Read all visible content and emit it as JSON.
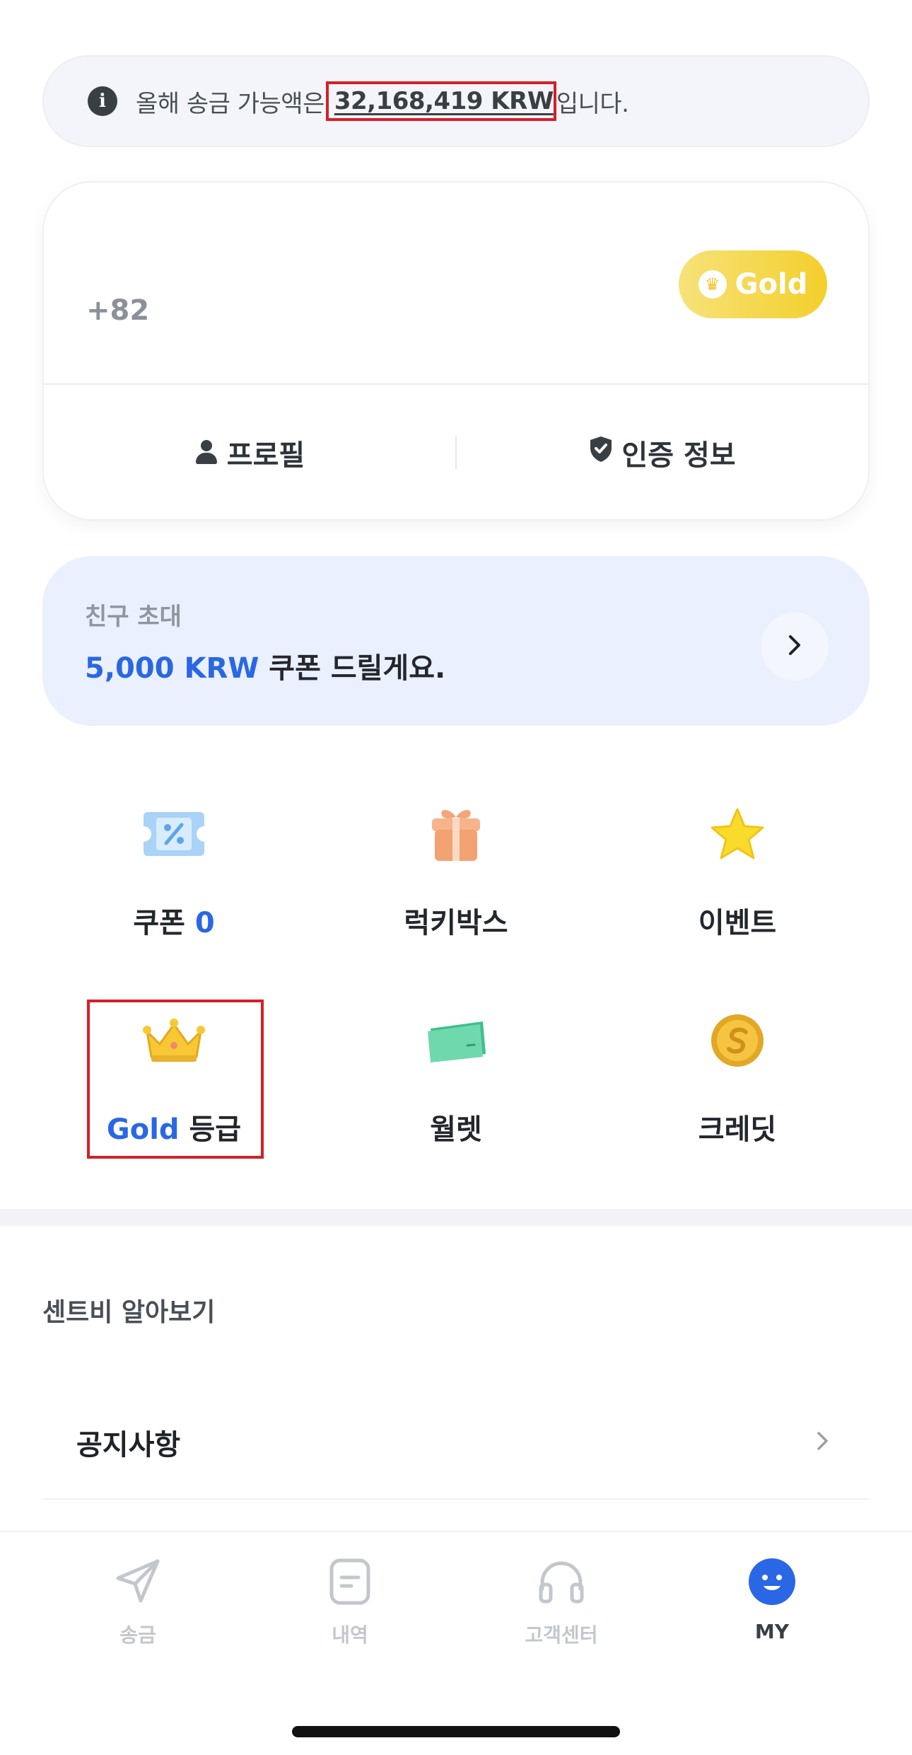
{
  "notice": {
    "prefix": "올해 송금 가능액은 ",
    "amount": "32,168,419 KRW",
    "suffix": "입니다."
  },
  "profile": {
    "phone": "+82",
    "grade_badge": "Gold",
    "actions": {
      "profile_label": "프로필",
      "verification_label": "인증 정보"
    }
  },
  "invite": {
    "label": "친구 초대",
    "amount": "5,000 KRW",
    "text": " 쿠폰 드릴게요."
  },
  "grid": {
    "coupon": {
      "label": "쿠폰 ",
      "count": "0"
    },
    "luckybox": {
      "label": "럭키박스"
    },
    "event": {
      "label": "이벤트"
    },
    "grade": {
      "grade": "Gold",
      "label": " 등급"
    },
    "wallet": {
      "label": "월렛"
    },
    "credit": {
      "label": "크레딧"
    }
  },
  "section": {
    "title": "센트비 알아보기",
    "notice_label": "공지사항"
  },
  "nav": {
    "items": [
      {
        "label": "송금",
        "icon": "paper-plane-icon",
        "active": false
      },
      {
        "label": "내역",
        "icon": "document-icon",
        "active": false
      },
      {
        "label": "고객센터",
        "icon": "headset-icon",
        "active": false
      },
      {
        "label": "MY",
        "icon": "smiley-icon",
        "active": true
      }
    ]
  },
  "colors": {
    "accent": "#2a67e4",
    "gold": "#f3cf2b",
    "highlight": "#d61f26"
  }
}
